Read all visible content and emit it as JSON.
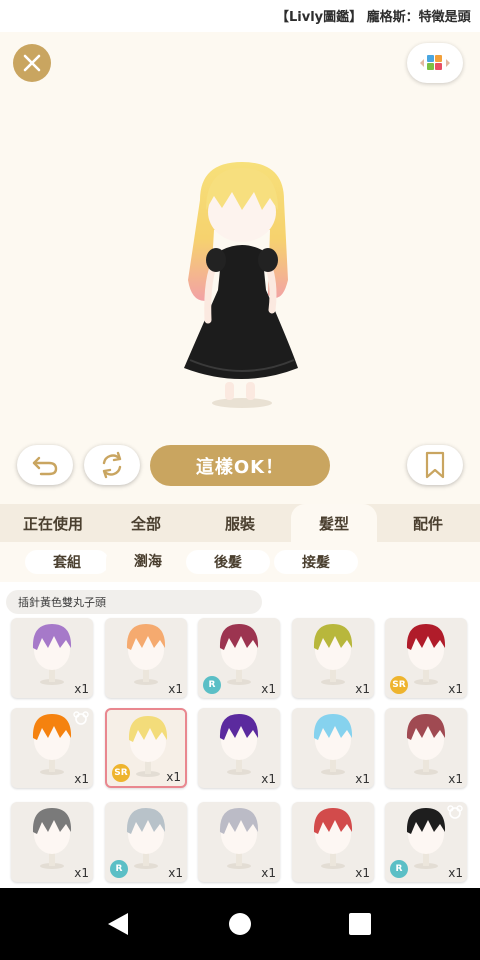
{
  "ticker": {
    "text": "【Livly圖鑑】 龐格斯：特徵是頭"
  },
  "buttons": {
    "ok_label": "這樣OK！"
  },
  "tabs": [
    {
      "label": "正在使用",
      "active": false
    },
    {
      "label": "全部",
      "active": false
    },
    {
      "label": "服裝",
      "active": false
    },
    {
      "label": "髮型",
      "active": true
    },
    {
      "label": "配件",
      "active": false
    }
  ],
  "subtabs": [
    {
      "label": "套組",
      "active": false
    },
    {
      "label": "瀏海",
      "active": true
    },
    {
      "label": "後髮",
      "active": false
    },
    {
      "label": "接髮",
      "active": false
    }
  ],
  "selected_item_name": "插針黃色雙丸子頭",
  "items": [
    {
      "hair_color": "#a679c9",
      "quantity": "x1",
      "rarity": "",
      "bear": false,
      "selected": false
    },
    {
      "hair_color": "#f5aa6f",
      "quantity": "x1",
      "rarity": "",
      "bear": false,
      "selected": false
    },
    {
      "hair_color": "#9c3450",
      "quantity": "x1",
      "rarity": "R",
      "bear": false,
      "selected": false
    },
    {
      "hair_color": "#b8b73c",
      "quantity": "x1",
      "rarity": "",
      "bear": false,
      "selected": false
    },
    {
      "hair_color": "#b01c2a",
      "quantity": "x1",
      "rarity": "SR",
      "bear": false,
      "selected": false
    },
    {
      "hair_color": "#f5820f",
      "quantity": "x1",
      "rarity": "",
      "bear": true,
      "selected": false
    },
    {
      "hair_color": "#f3dc7a",
      "quantity": "x1",
      "rarity": "SR",
      "bear": false,
      "selected": true
    },
    {
      "hair_color": "#5b2a9e",
      "quantity": "x1",
      "rarity": "",
      "bear": false,
      "selected": false
    },
    {
      "hair_color": "#86d2ee",
      "quantity": "x1",
      "rarity": "",
      "bear": false,
      "selected": false
    },
    {
      "hair_color": "#a04a52",
      "quantity": "x1",
      "rarity": "",
      "bear": false,
      "selected": false
    },
    {
      "hair_color": "#7a7a7a",
      "quantity": "x1",
      "rarity": "",
      "bear": false,
      "selected": false
    },
    {
      "hair_color": "#b8c2c9",
      "quantity": "x1",
      "rarity": "R",
      "bear": false,
      "selected": false
    },
    {
      "hair_color": "#bbbbc6",
      "quantity": "x1",
      "rarity": "",
      "bear": false,
      "selected": false
    },
    {
      "hair_color": "#d24b4b",
      "quantity": "x1",
      "rarity": "",
      "bear": false,
      "selected": false
    },
    {
      "hair_color": "#1e1e1e",
      "quantity": "x1",
      "rarity": "R",
      "bear": true,
      "selected": false
    }
  ],
  "colors": {
    "accent": "#c9a560",
    "selected_border": "#e9878f",
    "r_badge": "#5bbfc6",
    "sr_badge": "#eeb42e"
  }
}
